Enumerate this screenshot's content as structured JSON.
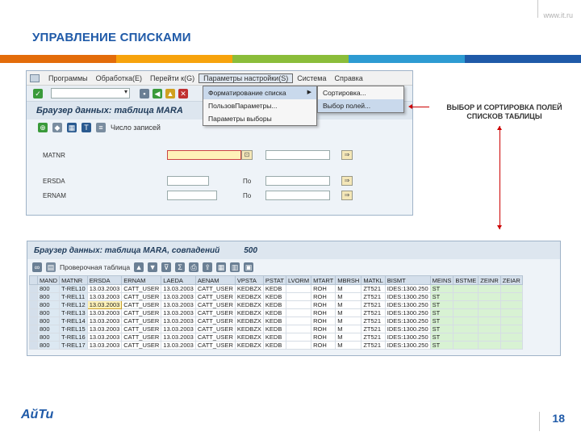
{
  "header": {
    "site_url": "www.it.ru",
    "title": "УПРАВЛЕНИЕ СПИСКАМИ"
  },
  "colors": {
    "title": "#1f5aa8",
    "stripes": [
      "#e36c0a",
      "#f7a30c",
      "#8bbd3a",
      "#2d9bd2",
      "#1f5aa8"
    ],
    "callout_arrow": "#cc0000"
  },
  "callout": {
    "line1": "ВЫБОР И СОРТИРОВКА ПОЛЕЙ",
    "line2": "СПИСКОВ ТАБЛИЦЫ"
  },
  "sap1": {
    "menu": [
      "Программы",
      "Обработка(E)",
      "Перейти к(G)",
      "Параметры настройки(S)",
      "Система",
      "Справка"
    ],
    "dropdown": [
      "Форматирование списка",
      "ПользовПараметры...",
      "Параметры выборы"
    ],
    "submenu": [
      "Сортировка...",
      "Выбор полей..."
    ],
    "screen_title": "Браузер данных: таблица MARA",
    "apptoolbar_label": "Число записей",
    "fields": [
      {
        "label": "MATNR",
        "to": ""
      },
      {
        "label": "ERSDA",
        "to": "По"
      },
      {
        "label": "ERNAM",
        "to": "По"
      }
    ]
  },
  "sap2": {
    "title": "Браузер данных: таблица MARA, совпадений",
    "count": "500",
    "toolbar_label": "Проверочная таблица",
    "columns": [
      "MAND",
      "MATNR",
      "ERSDA",
      "ERNAM",
      "LAEDA",
      "AENAM",
      "VPSTA",
      "PSTAT",
      "LVORM",
      "MTART",
      "MBRSH",
      "MATKL",
      "BISMT",
      "MEINS",
      "BSTME",
      "ZEINR",
      "ZEIAR"
    ],
    "rows": [
      [
        "800",
        "T-REL10",
        "13.03.2003",
        "CATT_USER",
        "13.03.2003",
        "CATT_USER",
        "KEDBZX",
        "KEDB",
        "",
        "ROH",
        "M",
        "ZT521",
        "IDES:1300.250",
        "ST",
        "",
        "",
        ""
      ],
      [
        "800",
        "T-REL11",
        "13.03.2003",
        "CATT_USER",
        "13.03.2003",
        "CATT_USER",
        "KEDBZX",
        "KEDB",
        "",
        "ROH",
        "M",
        "ZT521",
        "IDES:1300.250",
        "ST",
        "",
        "",
        ""
      ],
      [
        "800",
        "T-REL12",
        "13.03.2003",
        "CATT_USER",
        "13.03.2003",
        "CATT_USER",
        "KEDBZX",
        "KEDB",
        "",
        "ROH",
        "M",
        "ZT521",
        "IDES:1300.250",
        "ST",
        "",
        "",
        ""
      ],
      [
        "800",
        "T-REL13",
        "13.03.2003",
        "CATT_USER",
        "13.03.2003",
        "CATT_USER",
        "KEDBZX",
        "KEDB",
        "",
        "ROH",
        "M",
        "ZT521",
        "IDES:1300.250",
        "ST",
        "",
        "",
        ""
      ],
      [
        "800",
        "T-REL14",
        "13.03.2003",
        "CATT_USER",
        "13.03.2003",
        "CATT_USER",
        "KEDBZX",
        "KEDB",
        "",
        "ROH",
        "M",
        "ZT521",
        "IDES:1300.250",
        "ST",
        "",
        "",
        ""
      ],
      [
        "800",
        "T-REL15",
        "13.03.2003",
        "CATT_USER",
        "13.03.2003",
        "CATT_USER",
        "KEDBZX",
        "KEDB",
        "",
        "ROH",
        "M",
        "ZT521",
        "IDES:1300.250",
        "ST",
        "",
        "",
        ""
      ],
      [
        "800",
        "T-REL16",
        "13.03.2003",
        "CATT_USER",
        "13.03.2003",
        "CATT_USER",
        "KEDBZX",
        "KEDB",
        "",
        "ROH",
        "M",
        "ZT521",
        "IDES:1300.250",
        "ST",
        "",
        "",
        ""
      ],
      [
        "800",
        "T-REL17",
        "13.03.2003",
        "CATT_USER",
        "13.03.2003",
        "CATT_USER",
        "KEDBZX",
        "KEDB",
        "",
        "ROH",
        "M",
        "ZT521",
        "IDES:1300.250",
        "ST",
        "",
        "",
        ""
      ]
    ]
  },
  "footer": {
    "logo": "АйТи",
    "page_number": "18"
  }
}
